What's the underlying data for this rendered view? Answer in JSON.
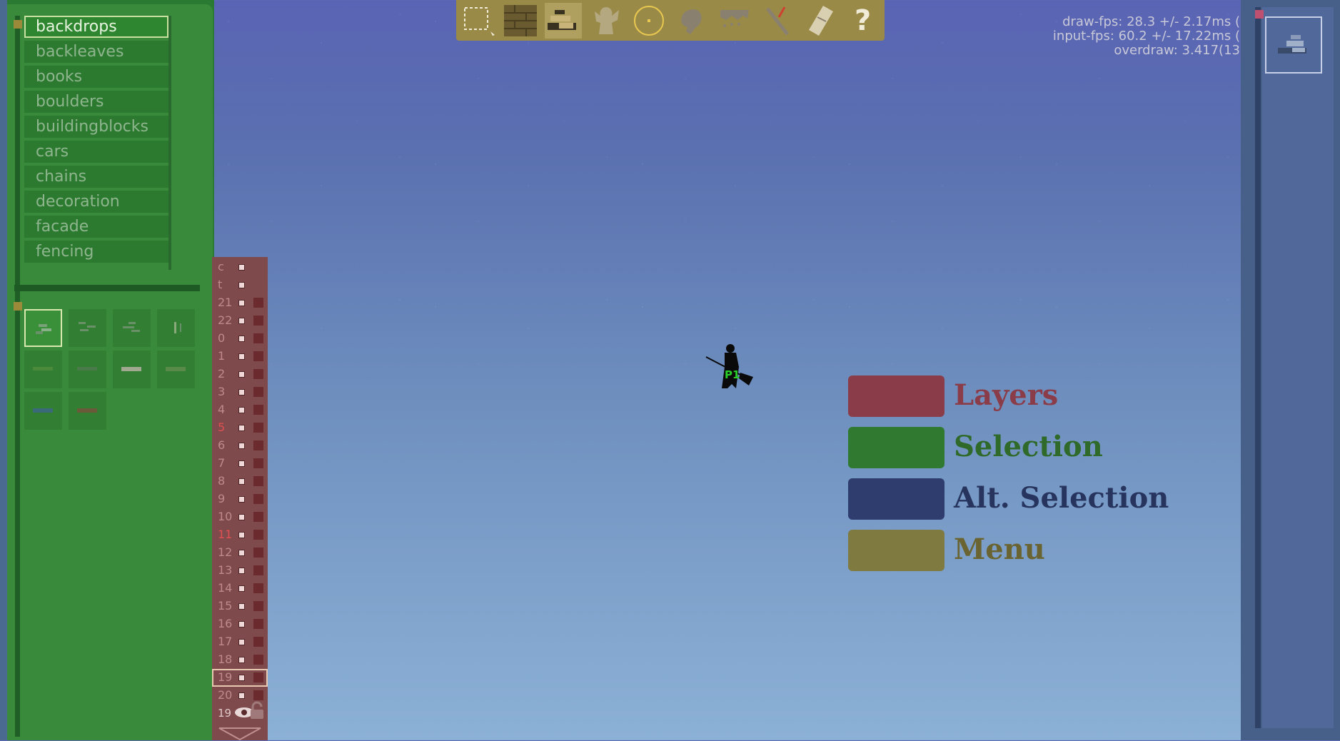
{
  "categories": {
    "items": [
      "backdrops",
      "backleaves",
      "books",
      "boulders",
      "buildingblocks",
      "cars",
      "chains",
      "decoration",
      "facade",
      "fencing"
    ],
    "selected": "backdrops"
  },
  "layers": {
    "rows": [
      "c",
      "t",
      "21",
      "22",
      "0",
      "1",
      "2",
      "3",
      "4",
      "5",
      "6",
      "7",
      "8",
      "9",
      "10",
      "11",
      "12",
      "13",
      "14",
      "15",
      "16",
      "17",
      "18",
      "19",
      "20"
    ],
    "red_rows": [
      "5",
      "11"
    ],
    "current_layer_label": "19"
  },
  "toolbar": {
    "tools": [
      "select-tool",
      "tiles-tool",
      "props-tool",
      "creature-tool",
      "point-tool",
      "sound-tool",
      "area-tool",
      "sword-tool",
      "scroll-tool",
      "help-tool"
    ],
    "help_label": "?"
  },
  "debug": {
    "draw_fps": "draw-fps: 28.3 +/- 2.17ms (",
    "input_fps": "input-fps: 60.2 +/- 17.22ms (",
    "overdraw": "overdraw: 3.417(13"
  },
  "player": {
    "label": "P1"
  },
  "legend": [
    {
      "label": "Layers",
      "color": "#8a3c48",
      "text_color": "#8a3c48"
    },
    {
      "label": "Selection",
      "color": "#2f7a30",
      "text_color": "#2f6a2a"
    },
    {
      "label": "Alt. Selection",
      "color": "#2e3c6e",
      "text_color": "#26345e"
    },
    {
      "label": "Menu",
      "color": "#7e7a40",
      "text_color": "#6a6432"
    }
  ]
}
